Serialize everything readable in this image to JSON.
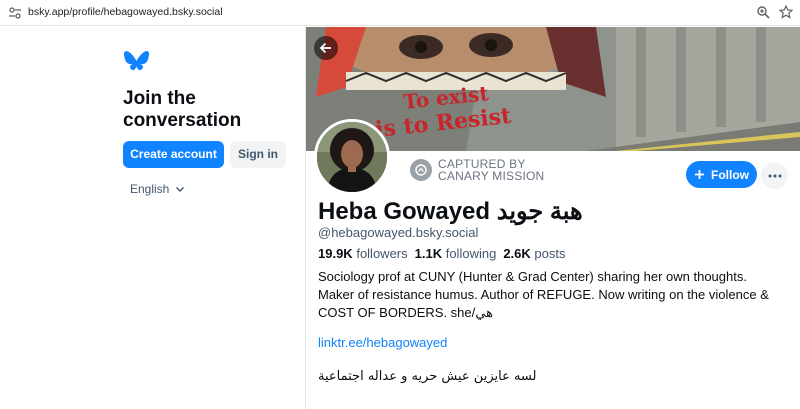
{
  "browser": {
    "url": "bsky.app/profile/hebagowayed.bsky.social"
  },
  "sidebar": {
    "join_title": "Join the conversation",
    "create_account_label": "Create account",
    "sign_in_label": "Sign in",
    "language": "English",
    "brand_color": "#1083fe"
  },
  "profile": {
    "captured_line1": "CAPTURED BY",
    "captured_line2": "CANARY MISSION",
    "follow_label": "Follow",
    "display_name": "Heba Gowayed هبة جويد",
    "handle": "@hebagowayed.bsky.social",
    "followers_count": "19.9K",
    "followers_label": "followers",
    "following_count": "1.1K",
    "following_label": "following",
    "posts_count": "2.6K",
    "posts_label": "posts",
    "bio_line1": "Sociology prof at CUNY (Hunter & Grad Center) sharing her own thoughts.",
    "bio_line2": "Maker of resistance humus. Author of REFUGE. Now writing on the violence &",
    "bio_line3": "COST OF BORDERS. she/هي",
    "bio_link": "linktr.ee/hebagowayed",
    "bio_arabic": "لسه عايزين عيش حريه و عداله اجتماعية",
    "banner_text_1": "To exist",
    "banner_text_2": "is to Resist"
  },
  "icons": {
    "site": "site-settings-icon",
    "zoom": "zoom-icon",
    "star": "bookmark-star-icon",
    "logo": "bluesky-butterfly-icon",
    "chevron": "chevron-down-icon",
    "back": "back-arrow-icon",
    "captured": "canary-mission-icon",
    "plus": "plus-icon",
    "more": "more-dots-icon"
  }
}
